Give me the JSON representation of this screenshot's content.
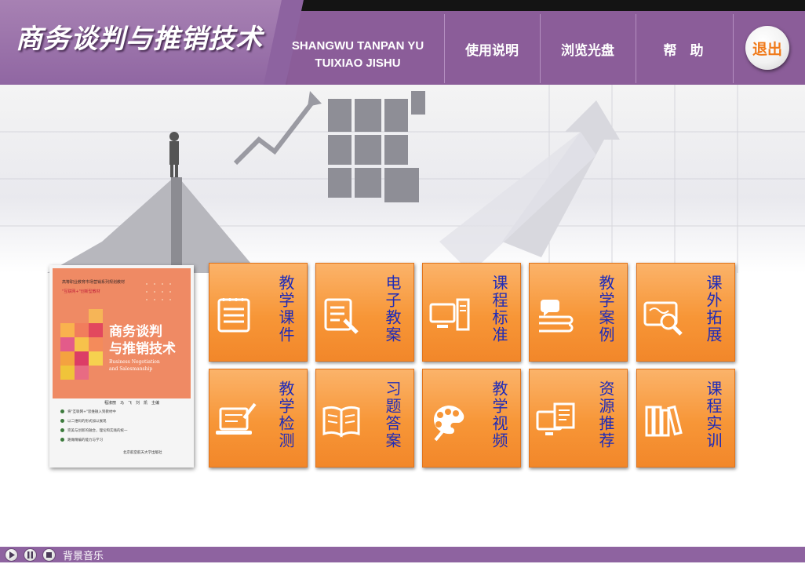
{
  "header": {
    "title": "商务谈判与推销技术",
    "pinyin_line1": "SHANGWU TANPAN YU",
    "pinyin_line2": "TUIXIAO JISHU",
    "nav": [
      {
        "label": "使用说明"
      },
      {
        "label": "浏览光盘"
      },
      {
        "label": "帮　助"
      }
    ],
    "exit_label": "退出"
  },
  "book": {
    "series": "高等职业教育市场营销系列规划教材",
    "tag": "\"互联网+\"创新型教材",
    "title_line1": "商务谈判",
    "title_line2": "与推销技术",
    "en_line1": "Business Negotiation",
    "en_line2": "and Salesmanship",
    "authors": "程淑丽　马　飞　刘　凯　主编",
    "bullets": [
      "将\"互联网+\"思维融入到教材中",
      "以二维码的形式加以展现",
      "完美与创新的融合，理论和实践的统一",
      "路做精编的能力与学习"
    ],
    "publisher": "北京航空航天大学出版社"
  },
  "tiles": [
    {
      "label": "教学课件",
      "icon": "notepad-icon"
    },
    {
      "label": "电子教案",
      "icon": "document-pen-icon"
    },
    {
      "label": "课程标准",
      "icon": "computer-icon"
    },
    {
      "label": "教学案例",
      "icon": "chat-book-icon"
    },
    {
      "label": "课外拓展",
      "icon": "map-search-icon"
    },
    {
      "label": "教学检测",
      "icon": "laptop-pen-icon"
    },
    {
      "label": "习题答案",
      "icon": "open-book-icon"
    },
    {
      "label": "教学视频",
      "icon": "palette-icon"
    },
    {
      "label": "资源推荐",
      "icon": "monitor-pages-icon"
    },
    {
      "label": "课程实训",
      "icon": "bookshelf-icon"
    }
  ],
  "footer": {
    "music_label": "背景音乐"
  },
  "colors": {
    "header_purple": "#8b5d99",
    "tile_orange": "#f79637",
    "tile_text_blue": "#1e2bb8",
    "exit_orange": "#f07a1a"
  }
}
